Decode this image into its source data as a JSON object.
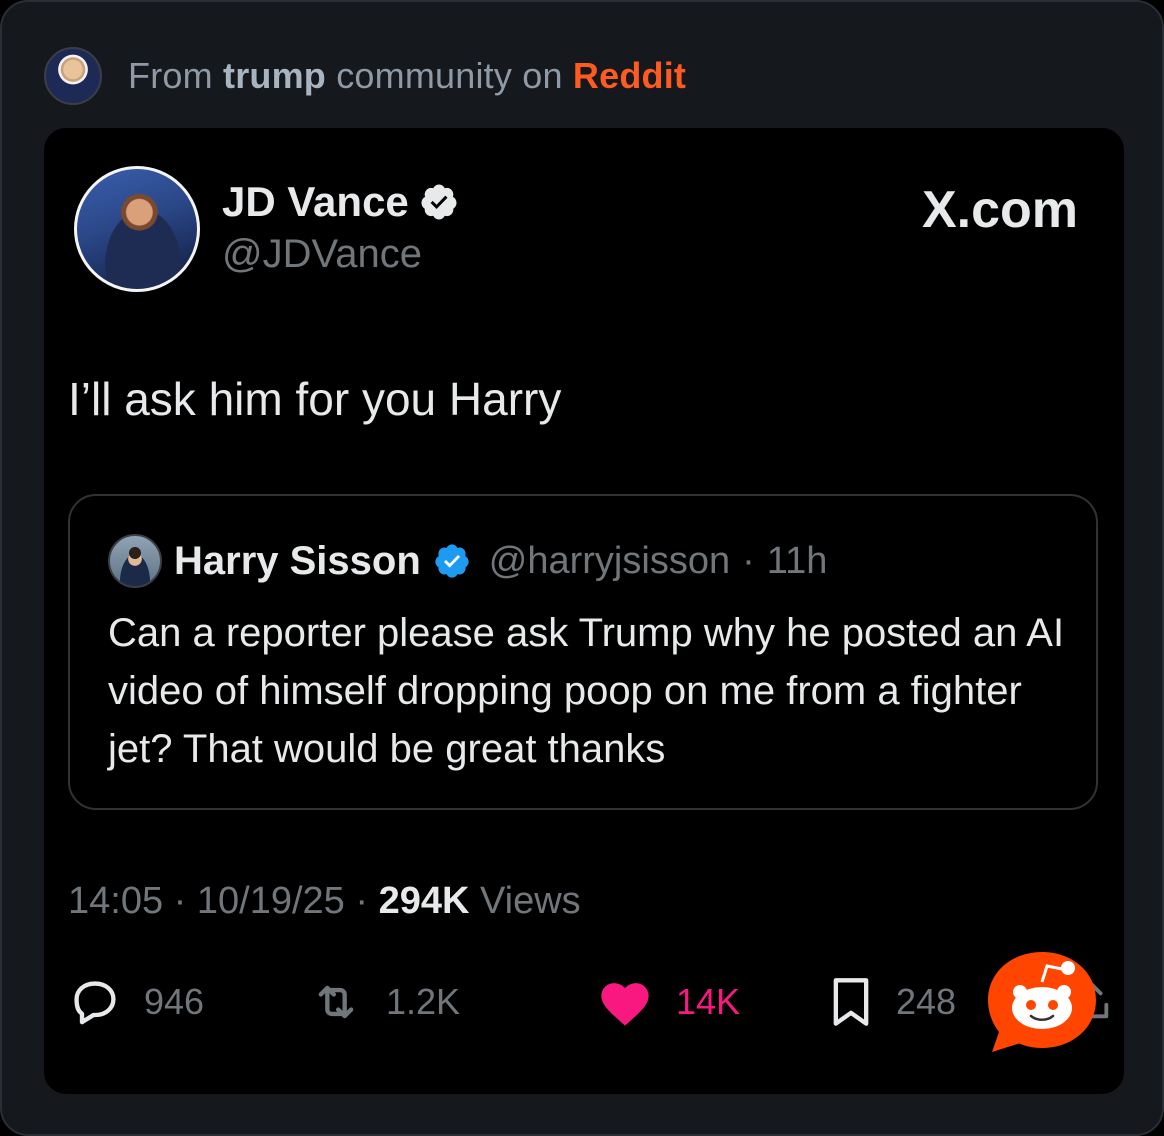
{
  "source": {
    "prefix": "From",
    "community": "trump",
    "middle": "community on",
    "platform": "Reddit"
  },
  "tweet": {
    "author_name": "JD Vance",
    "author_handle": "@JDVance",
    "site": "X.com",
    "text": "I’ll ask him for you Harry",
    "quote": {
      "name": "Harry Sisson",
      "handle": "@harryjsisson",
      "sep": "·",
      "age": "11h",
      "text": "Can a reporter please ask Trump why he posted an AI video of himself dropping poop on me from a fighter jet? That would be great thanks"
    },
    "time": "14:05",
    "date": "10/19/25",
    "sep": "·",
    "views_count": "294K",
    "views_label": "Views",
    "actions": {
      "replies": "946",
      "reposts": "1.2K",
      "likes": "14K",
      "bookmarks": "248"
    }
  },
  "colors": {
    "accent_reddit": "#ff5a1f",
    "like_pink": "#f91880",
    "verified_blue": "#1d9bf0"
  },
  "icons": [
    "reddit-community-avatar",
    "verified-badge-icon",
    "reply-icon",
    "repost-icon",
    "heart-icon",
    "bookmark-icon",
    "share-icon",
    "reddit-snoo-icon"
  ]
}
